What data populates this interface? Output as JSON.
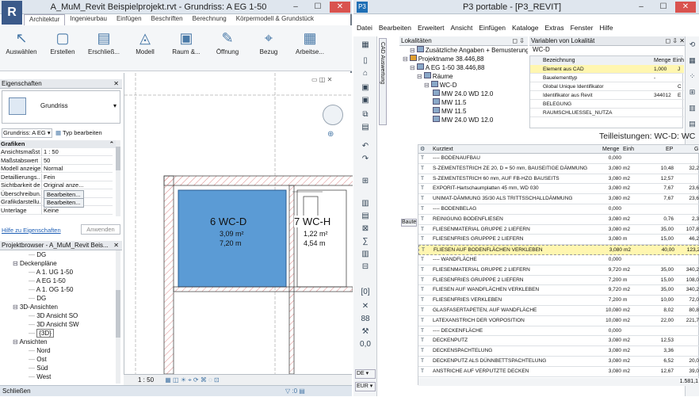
{
  "revit": {
    "title": "A_MuM_Revit Beispielprojekt.rvt - Grundriss: A EG 1-50",
    "tabs": [
      "Architektur",
      "Ingenieurbau",
      "Einfügen",
      "Beschriften",
      "Berechnung",
      "Körpermodell & Grundstück"
    ],
    "ribbon": [
      "Auswählen",
      "Erstellen",
      "Erschließ...",
      "Modell",
      "Raum &...",
      "Öffnung",
      "Bezug",
      "Arbeitse..."
    ],
    "properties_title": "Eigenschaften",
    "type_label": "Grundriss",
    "selector": "Grundriss: A EG",
    "edit_type": "Typ bearbeiten",
    "graphics": "Grafiken",
    "props": [
      {
        "k": "Ansichtsmaßst...",
        "v": "1 : 50"
      },
      {
        "k": "Maßstabswert 1:",
        "v": "50"
      },
      {
        "k": "Modell anzeigen",
        "v": "Normal"
      },
      {
        "k": "Detaillierungs...",
        "v": "Fein"
      },
      {
        "k": "Sichtbarkeit de...",
        "v": "Original anze..."
      },
      {
        "k": "Überschreibun...",
        "v": "Bearbeiten..."
      },
      {
        "k": "Grafikdarstellu...",
        "v": "Bearbeiten..."
      },
      {
        "k": "Unterlage",
        "v": "Keine"
      }
    ],
    "help_link": "Hilfe zu Eigenschaften",
    "apply": "Anwenden",
    "browser_title": "Projektbrowser - A_MuM_Revit Beis...",
    "tree": [
      {
        "t": "DG",
        "lv": 3
      },
      {
        "t": "Deckenpläne",
        "lv": 1
      },
      {
        "t": "A 1. UG 1-50",
        "lv": 3
      },
      {
        "t": "A EG 1-50",
        "lv": 3
      },
      {
        "t": "A 1. OG 1-50",
        "lv": 3
      },
      {
        "t": "DG",
        "lv": 3
      },
      {
        "t": "3D-Ansichten",
        "lv": 1
      },
      {
        "t": "3D Ansicht SO",
        "lv": 3
      },
      {
        "t": "3D Ansicht SW",
        "lv": 3
      },
      {
        "t": "{3D}",
        "lv": 3
      },
      {
        "t": "Ansichten",
        "lv": 1
      },
      {
        "t": "Nord",
        "lv": 3
      },
      {
        "t": "Ost",
        "lv": 3
      },
      {
        "t": "Süd",
        "lv": 3
      },
      {
        "t": "West",
        "lv": 3
      }
    ],
    "room1": {
      "name": "6 WC-D",
      "area": "3,09 m²",
      "perim": "7,20 m"
    },
    "room2": {
      "name": "7 WC-H",
      "area": "1,22 m²",
      "perim": "4,54 m"
    },
    "scale": "1 : 50",
    "status": "Schließen"
  },
  "p3": {
    "title": "P3 portable - [P3_REVIT]",
    "menu": [
      "Datei",
      "Bearbeiten",
      "Erweitert",
      "Ansicht",
      "Einfügen",
      "Kataloge",
      "Extras",
      "Fenster",
      "Hilfe"
    ],
    "loc_title": "Lokalitäten",
    "loc_tree": [
      {
        "t": "Zusätzliche Angaben + Bemusterung",
        "lv": 1
      },
      {
        "t": "Projektname 38.446,88",
        "lv": 0
      },
      {
        "t": "A EG 1-50 38.446,88",
        "lv": 1
      },
      {
        "t": "Räume",
        "lv": 2
      },
      {
        "t": "WC-D",
        "lv": 3
      },
      {
        "t": "MW 24.0 WD 12.0",
        "lv": 4
      },
      {
        "t": "MW 11.5",
        "lv": 4
      },
      {
        "t": "MW 11.5",
        "lv": 4
      },
      {
        "t": "MW 24.0 WD 12.0",
        "lv": 4
      }
    ],
    "var_title": "Variablen von Lokalität",
    "var_sub": "WC-D",
    "var_head": [
      "Bezeichnung",
      "Menge",
      "Einh"
    ],
    "vars": [
      {
        "n": "Element aus CAD",
        "m": "1,000",
        "e": "J"
      },
      {
        "n": "Bauelementtyp",
        "m": "-",
        "e": ""
      },
      {
        "n": "Global Unique Identifikator",
        "m": "",
        "e": "C"
      },
      {
        "n": "Identifikator aus Revit",
        "m": "344012",
        "e": "E"
      },
      {
        "n": "BELEGUNG",
        "m": "",
        "e": ""
      },
      {
        "n": "RAUMSCHLUESSEL_NUTZA",
        "m": "",
        "e": ""
      }
    ],
    "vert_label": "CAD Auswertung",
    "bauteil_label": "Baute",
    "currency": "EUR",
    "lang": "DE",
    "num88": "88",
    "grid_title": "Teilleistungen: WC-D: WC",
    "head": [
      "Kurztext",
      "Menge",
      "Einh",
      "EP",
      "G"
    ],
    "rows": [
      {
        "t": "---- BODENAUFBAU",
        "m": "0,000",
        "e": "",
        "ep": "",
        "g": ""
      },
      {
        "t": "S-ZEMENTESTRICH ZE 20, D = 50 mm, BAUSEITIGE DÄMMUNG",
        "m": "3,080",
        "e": "m2",
        "ep": "10,48",
        "g": "32,2"
      },
      {
        "t": "S-ZEMENTESTRICH 60 mm, AUF FB-HZG BAUSEITS",
        "m": "3,080",
        "e": "m2",
        "ep": "12,57",
        "g": ""
      },
      {
        "t": "EXPORIT-Hartschaumplatten 45 mm, WD 030",
        "m": "3,080",
        "e": "m2",
        "ep": "7,67",
        "g": "23,6"
      },
      {
        "t": "UNIMAT-DÄMMUNG 35/30 ALS TRITTSSCHALLDÄMMUNG",
        "m": "3,080",
        "e": "m2",
        "ep": "7,67",
        "g": "23,6"
      },
      {
        "t": "---- BODENBELAG",
        "m": "0,000",
        "e": "",
        "ep": "",
        "g": ""
      },
      {
        "t": "REINIGUNG BODENFLIESEN",
        "m": "3,080",
        "e": "m2",
        "ep": "0,76",
        "g": "2,3"
      },
      {
        "t": "FLIESENMATERIAL GRUPPE 2 LIEFERN",
        "m": "3,080",
        "e": "m2",
        "ep": "35,00",
        "g": "107,8"
      },
      {
        "t": "FLIESENFRIES GRUPPPE 2 LIEFERN",
        "m": "3,080",
        "e": "m",
        "ep": "15,00",
        "g": "46,2"
      },
      {
        "t": "FLIESEN AUF BODENFLÄCHEN VERKLEBEN",
        "m": "3,080",
        "e": "m2",
        "ep": "40,00",
        "g": "123,2"
      },
      {
        "t": "---- WANDFLÄCHE",
        "m": "0,000",
        "e": "",
        "ep": "",
        "g": ""
      },
      {
        "t": "FLIESENMATERIAL GRUPPE 2 LIEFERN",
        "m": "9,720",
        "e": "m2",
        "ep": "35,00",
        "g": "340,2"
      },
      {
        "t": "FLIESENFRIES GRUPPPE 2 LIEFERN",
        "m": "7,200",
        "e": "m",
        "ep": "15,00",
        "g": "108,0"
      },
      {
        "t": "FLIESEN AUF WANDFLÄCHEN VERKLEBEN",
        "m": "9,720",
        "e": "m2",
        "ep": "35,00",
        "g": "340,2"
      },
      {
        "t": "FLIESENFRIES VERKLEBEN",
        "m": "7,200",
        "e": "m",
        "ep": "10,00",
        "g": "72,0"
      },
      {
        "t": "GLASFASERTAPETEN, AUF WANDFLÄCHE",
        "m": "10,080",
        "e": "m2",
        "ep": "8,02",
        "g": "80,8"
      },
      {
        "t": "LATEXANSTRICH DER VORPOSITION",
        "m": "10,080",
        "e": "m2",
        "ep": "22,00",
        "g": "221,7"
      },
      {
        "t": "---- DECKENFLÄCHE",
        "m": "0,000",
        "e": "",
        "ep": "",
        "g": ""
      },
      {
        "t": "DECKENPUTZ",
        "m": "3,080",
        "e": "m2",
        "ep": "12,53",
        "g": ""
      },
      {
        "t": "DECKENSPACHTELUNG",
        "m": "3,080",
        "e": "m2",
        "ep": "3,36",
        "g": ""
      },
      {
        "t": "DECKENPUTZ ALS DÜNNBETTSPACHTELUNG",
        "m": "3,080",
        "e": "m2",
        "ep": "6,52",
        "g": "20,0"
      },
      {
        "t": "ANSTRICHE AUF VERPUTZTE DECKEN",
        "m": "3,080",
        "e": "m2",
        "ep": "12,67",
        "g": "39,0"
      }
    ],
    "footer_total": "1.581,1",
    "highlight_index": 9
  },
  "colors": {
    "room": "#5b9bd5",
    "highlight": "#fff6b0",
    "p3bar": "#1f6fb5"
  }
}
